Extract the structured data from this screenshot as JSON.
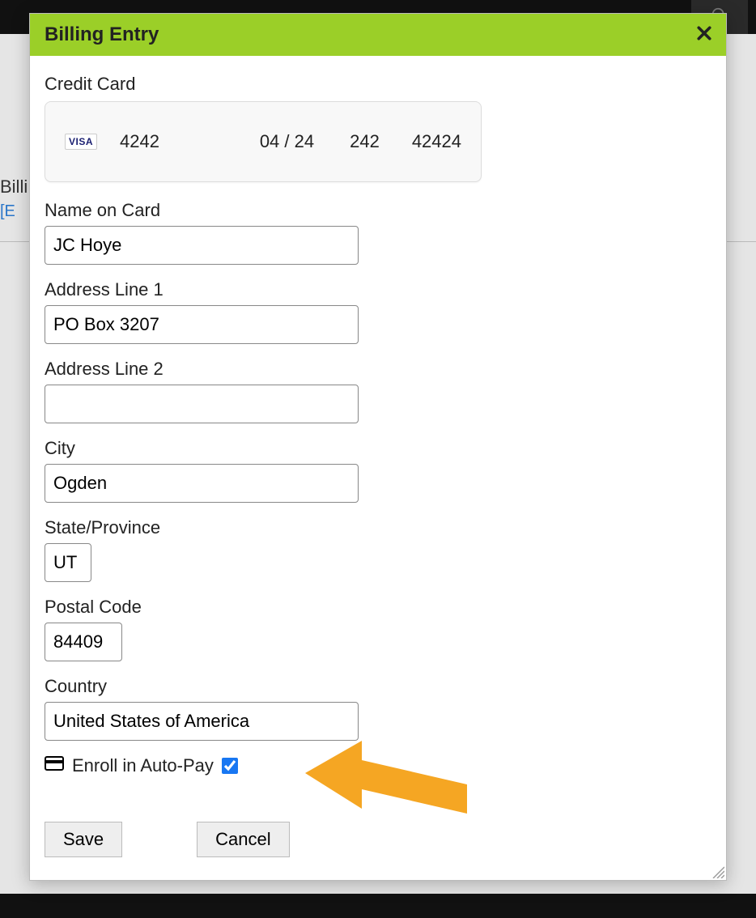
{
  "background": {
    "text1": "Billi",
    "text2": "[E"
  },
  "modal": {
    "title": "Billing Entry",
    "credit_card_label": "Credit Card",
    "card": {
      "brand": "VISA",
      "last4": "4242",
      "exp": "04 / 24",
      "cvc": "242",
      "zip": "42424"
    },
    "fields": {
      "name_label": "Name on Card",
      "name_value": "JC Hoye",
      "addr1_label": "Address Line 1",
      "addr1_value": "PO Box 3207",
      "addr2_label": "Address Line 2",
      "addr2_value": "",
      "city_label": "City",
      "city_value": "Ogden",
      "state_label": "State/Province",
      "state_value": "UT",
      "postal_label": "Postal Code",
      "postal_value": "84409",
      "country_label": "Country",
      "country_value": "United States of America"
    },
    "autopay_label": "Enroll in Auto-Pay",
    "autopay_checked": true,
    "buttons": {
      "save": "Save",
      "cancel": "Cancel"
    }
  },
  "colors": {
    "header_green": "#9bcf28",
    "arrow_orange": "#f5a623",
    "checkbox_blue": "#1877f2"
  }
}
